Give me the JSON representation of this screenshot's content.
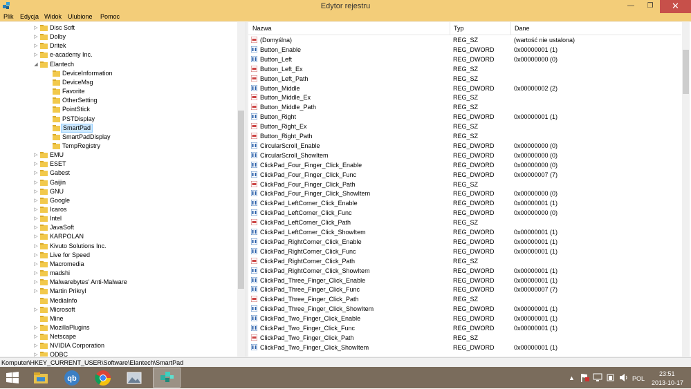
{
  "window": {
    "title": "Edytor rejestru",
    "minimize": "—",
    "maximize": "❐",
    "close": "✕"
  },
  "menu": [
    "Plik",
    "Edycja",
    "Widok",
    "Ulubione",
    "Pomoc"
  ],
  "tree": [
    {
      "label": "Disc Soft",
      "exp": "▷",
      "depth": 0
    },
    {
      "label": "Dolby",
      "exp": "▷",
      "depth": 0
    },
    {
      "label": "Dritek",
      "exp": "▷",
      "depth": 0
    },
    {
      "label": "e-academy Inc.",
      "exp": "▷",
      "depth": 0
    },
    {
      "label": "Elantech",
      "exp": "◢",
      "depth": 0
    },
    {
      "label": "DeviceInformation",
      "exp": "",
      "depth": 1
    },
    {
      "label": "DeviceMsg",
      "exp": "",
      "depth": 1
    },
    {
      "label": "Favorite",
      "exp": "",
      "depth": 1
    },
    {
      "label": "OtherSetting",
      "exp": "",
      "depth": 1
    },
    {
      "label": "PointStick",
      "exp": "",
      "depth": 1
    },
    {
      "label": "PSTDisplay",
      "exp": "",
      "depth": 1
    },
    {
      "label": "SmartPad",
      "exp": "",
      "depth": 1,
      "selected": true
    },
    {
      "label": "SmartPadDisplay",
      "exp": "",
      "depth": 1
    },
    {
      "label": "TempRegistry",
      "exp": "",
      "depth": 1
    },
    {
      "label": "EMU",
      "exp": "▷",
      "depth": 0
    },
    {
      "label": "ESET",
      "exp": "▷",
      "depth": 0
    },
    {
      "label": "Gabest",
      "exp": "▷",
      "depth": 0
    },
    {
      "label": "Gaijin",
      "exp": "▷",
      "depth": 0
    },
    {
      "label": "GNU",
      "exp": "▷",
      "depth": 0
    },
    {
      "label": "Google",
      "exp": "▷",
      "depth": 0
    },
    {
      "label": "Icaros",
      "exp": "▷",
      "depth": 0
    },
    {
      "label": "Intel",
      "exp": "▷",
      "depth": 0
    },
    {
      "label": "JavaSoft",
      "exp": "▷",
      "depth": 0
    },
    {
      "label": "KARPOLAN",
      "exp": "▷",
      "depth": 0
    },
    {
      "label": "Kivuto Solutions Inc.",
      "exp": "▷",
      "depth": 0
    },
    {
      "label": "Live for Speed",
      "exp": "▷",
      "depth": 0
    },
    {
      "label": "Macromedia",
      "exp": "▷",
      "depth": 0
    },
    {
      "label": "madshi",
      "exp": "▷",
      "depth": 0
    },
    {
      "label": "Malwarebytes' Anti-Malware",
      "exp": "▷",
      "depth": 0
    },
    {
      "label": "Martin Prikryl",
      "exp": "▷",
      "depth": 0
    },
    {
      "label": "MediaInfo",
      "exp": "",
      "depth": 0
    },
    {
      "label": "Microsoft",
      "exp": "▷",
      "depth": 0
    },
    {
      "label": "Mine",
      "exp": "",
      "depth": 0
    },
    {
      "label": "MozillaPlugins",
      "exp": "▷",
      "depth": 0
    },
    {
      "label": "Netscape",
      "exp": "▷",
      "depth": 0
    },
    {
      "label": "NVIDIA Corporation",
      "exp": "▷",
      "depth": 0
    },
    {
      "label": "ODBC",
      "exp": "▷",
      "depth": 0
    }
  ],
  "columns": {
    "name": "Nazwa",
    "type": "Typ",
    "data": "Dane"
  },
  "values": [
    {
      "name": "(Domyślna)",
      "type": "REG_SZ",
      "data": "(wartość nie ustalona)",
      "kind": "sz"
    },
    {
      "name": "Button_Enable",
      "type": "REG_DWORD",
      "data": "0x00000001 (1)",
      "kind": "dw"
    },
    {
      "name": "Button_Left",
      "type": "REG_DWORD",
      "data": "0x00000000 (0)",
      "kind": "dw"
    },
    {
      "name": "Button_Left_Ex",
      "type": "REG_SZ",
      "data": "",
      "kind": "sz"
    },
    {
      "name": "Button_Left_Path",
      "type": "REG_SZ",
      "data": "",
      "kind": "sz"
    },
    {
      "name": "Button_Middle",
      "type": "REG_DWORD",
      "data": "0x00000002 (2)",
      "kind": "dw"
    },
    {
      "name": "Button_Middle_Ex",
      "type": "REG_SZ",
      "data": "",
      "kind": "sz"
    },
    {
      "name": "Button_Middle_Path",
      "type": "REG_SZ",
      "data": "",
      "kind": "sz"
    },
    {
      "name": "Button_Right",
      "type": "REG_DWORD",
      "data": "0x00000001 (1)",
      "kind": "dw"
    },
    {
      "name": "Button_Right_Ex",
      "type": "REG_SZ",
      "data": "",
      "kind": "sz"
    },
    {
      "name": "Button_Right_Path",
      "type": "REG_SZ",
      "data": "",
      "kind": "sz"
    },
    {
      "name": "CircularScroll_Enable",
      "type": "REG_DWORD",
      "data": "0x00000000 (0)",
      "kind": "dw"
    },
    {
      "name": "CircularScroll_ShowItem",
      "type": "REG_DWORD",
      "data": "0x00000000 (0)",
      "kind": "dw"
    },
    {
      "name": "ClickPad_Four_Finger_Click_Enable",
      "type": "REG_DWORD",
      "data": "0x00000000 (0)",
      "kind": "dw"
    },
    {
      "name": "ClickPad_Four_Finger_Click_Func",
      "type": "REG_DWORD",
      "data": "0x00000007 (7)",
      "kind": "dw"
    },
    {
      "name": "ClickPad_Four_Finger_Click_Path",
      "type": "REG_SZ",
      "data": "",
      "kind": "sz"
    },
    {
      "name": "ClickPad_Four_Finger_Click_ShowItem",
      "type": "REG_DWORD",
      "data": "0x00000000 (0)",
      "kind": "dw"
    },
    {
      "name": "ClickPad_LeftCorner_Click_Enable",
      "type": "REG_DWORD",
      "data": "0x00000001 (1)",
      "kind": "dw"
    },
    {
      "name": "ClickPad_LeftCorner_Click_Func",
      "type": "REG_DWORD",
      "data": "0x00000000 (0)",
      "kind": "dw"
    },
    {
      "name": "ClickPad_LeftCorner_Click_Path",
      "type": "REG_SZ",
      "data": "",
      "kind": "sz"
    },
    {
      "name": "ClickPad_LeftCorner_Click_ShowItem",
      "type": "REG_DWORD",
      "data": "0x00000001 (1)",
      "kind": "dw"
    },
    {
      "name": "ClickPad_RightCorner_Click_Enable",
      "type": "REG_DWORD",
      "data": "0x00000001 (1)",
      "kind": "dw"
    },
    {
      "name": "ClickPad_RightCorner_Click_Func",
      "type": "REG_DWORD",
      "data": "0x00000001 (1)",
      "kind": "dw"
    },
    {
      "name": "ClickPad_RightCorner_Click_Path",
      "type": "REG_SZ",
      "data": "",
      "kind": "sz"
    },
    {
      "name": "ClickPad_RightCorner_Click_ShowItem",
      "type": "REG_DWORD",
      "data": "0x00000001 (1)",
      "kind": "dw"
    },
    {
      "name": "ClickPad_Three_Finger_Click_Enable",
      "type": "REG_DWORD",
      "data": "0x00000001 (1)",
      "kind": "dw"
    },
    {
      "name": "ClickPad_Three_Finger_Click_Func",
      "type": "REG_DWORD",
      "data": "0x00000007 (7)",
      "kind": "dw"
    },
    {
      "name": "ClickPad_Three_Finger_Click_Path",
      "type": "REG_SZ",
      "data": "",
      "kind": "sz"
    },
    {
      "name": "ClickPad_Three_Finger_Click_ShowItem",
      "type": "REG_DWORD",
      "data": "0x00000001 (1)",
      "kind": "dw"
    },
    {
      "name": "ClickPad_Two_Finger_Click_Enable",
      "type": "REG_DWORD",
      "data": "0x00000001 (1)",
      "kind": "dw"
    },
    {
      "name": "ClickPad_Two_Finger_Click_Func",
      "type": "REG_DWORD",
      "data": "0x00000001 (1)",
      "kind": "dw"
    },
    {
      "name": "ClickPad_Two_Finger_Click_Path",
      "type": "REG_SZ",
      "data": "",
      "kind": "sz"
    },
    {
      "name": "ClickPad_Two_Finger_Click_ShowItem",
      "type": "REG_DWORD",
      "data": "0x00000001 (1)",
      "kind": "dw"
    }
  ],
  "statusbar": {
    "path": "Komputer\\HKEY_CURRENT_USER\\Software\\Elantech\\SmartPad"
  },
  "taskbar": {
    "apps": [
      "windows-logo-icon",
      "file-explorer-icon",
      "qbittorrent-icon",
      "chrome-icon",
      "photos-icon",
      "regedit-icon"
    ],
    "tray": {
      "language": "POL",
      "time": "23:51",
      "date": "2013-10-17"
    }
  },
  "colors": {
    "titlebar": "#f3cd79",
    "taskbar": "#7a6c5c",
    "selection": "#cce8ff",
    "close": "#c7504a"
  }
}
